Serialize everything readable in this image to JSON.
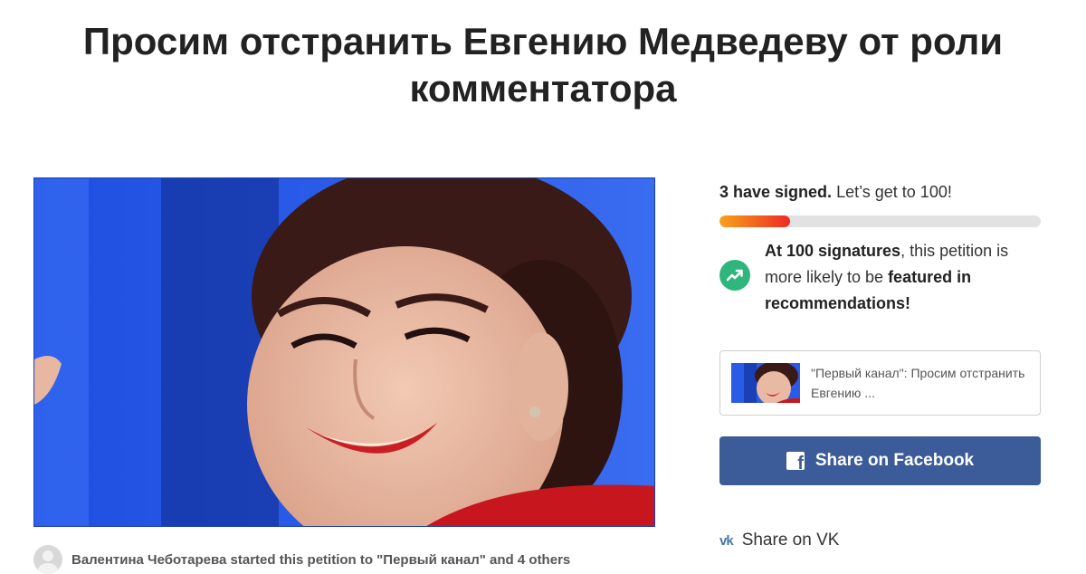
{
  "petition": {
    "title": "Просим отстранить Евгению Медведеву от роли комментатора",
    "author_line": "Валентина Чеботарева started this petition to \"Первый канал\" and 4 others"
  },
  "signatures": {
    "count_text": "3 have signed.",
    "goal_text": "Let’s get to 100!",
    "progress_fraction": 0.22,
    "milestone_strong": "At 100 signatures",
    "milestone_mid": ", this petition is more likely to be ",
    "milestone_featured": "featured in recommendations!"
  },
  "share": {
    "card_text": "\"Первый канал\": Просим отстранить Евгению ...",
    "facebook_label": "Share on Facebook",
    "vk_label": "Share on VK",
    "vk_icon_text": "vk"
  },
  "colors": {
    "facebook": "#3b5b99",
    "progress_start": "#f8a21b",
    "progress_end": "#ec2c22",
    "milestone_icon": "#2eb67d"
  },
  "icons": [
    "trend-up-icon",
    "facebook-icon",
    "vk-icon",
    "avatar-placeholder-icon"
  ]
}
